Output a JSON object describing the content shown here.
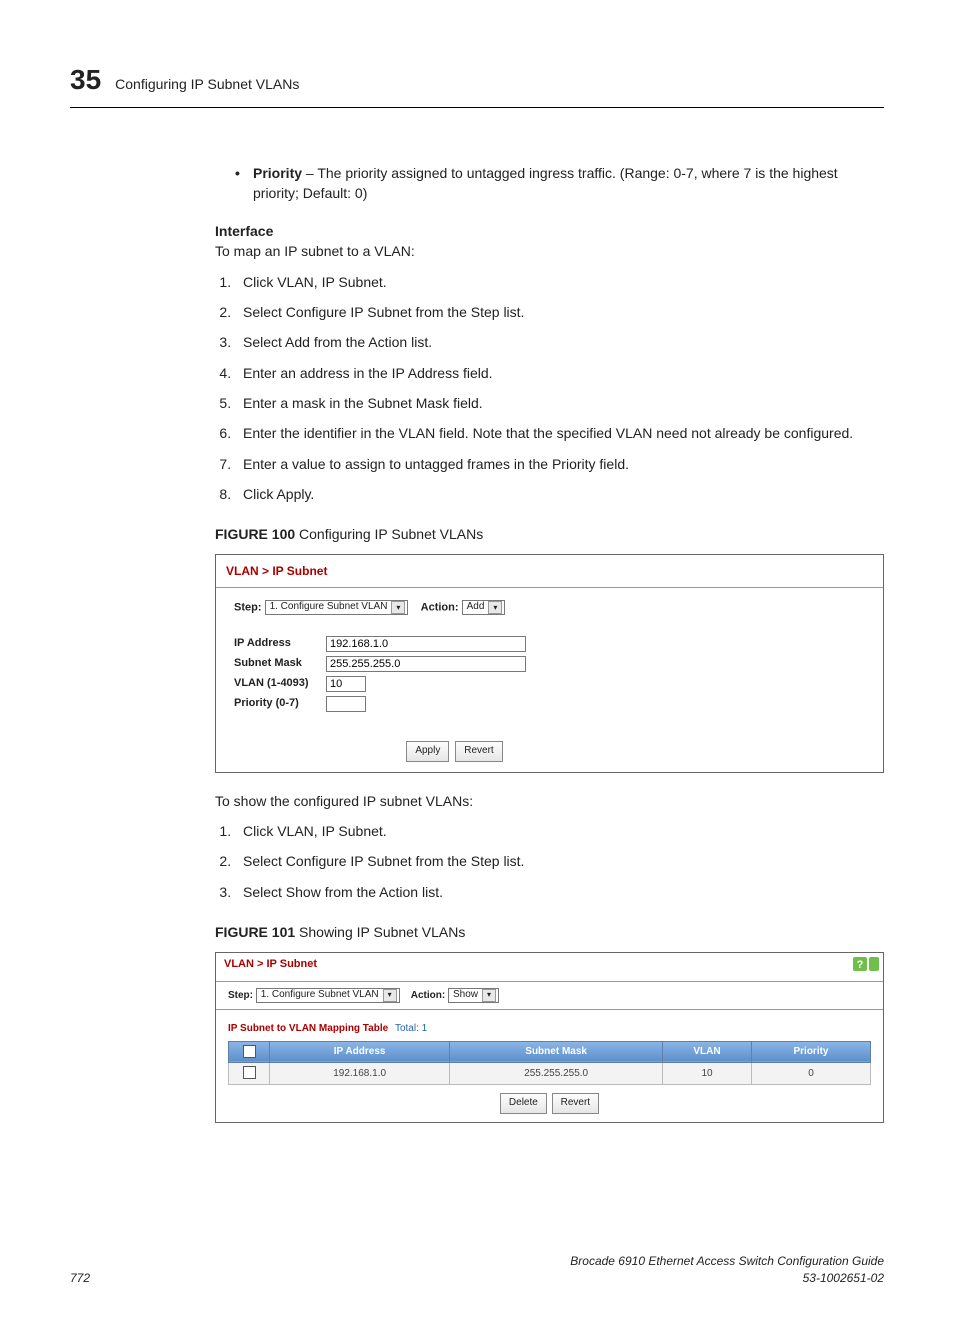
{
  "header": {
    "chapter_number": "35",
    "chapter_title": "Configuring IP Subnet VLANs"
  },
  "priority_bullet_label": "Priority",
  "priority_bullet_text": " – The priority assigned to untagged ingress traffic. (Range: 0-7, where 7 is the highest priority; Default: 0)",
  "interface": {
    "heading": "Interface",
    "intro": "To map an IP subnet to a VLAN:",
    "steps": [
      "Click VLAN, IP Subnet.",
      "Select Configure IP Subnet from the Step list.",
      "Select Add from the Action list.",
      "Enter an address in the IP Address field.",
      "Enter a mask in the Subnet Mask field.",
      "Enter the identifier in the VLAN field. Note that the specified VLAN need not already be configured.",
      "Enter a value to assign to untagged frames in the Priority field.",
      "Click Apply."
    ]
  },
  "figure100": {
    "label": "FIGURE 100",
    "title": "   Configuring IP Subnet VLANs",
    "breadcrumb": "VLAN > IP Subnet",
    "step_label": "Step:",
    "step_value": "1. Configure Subnet VLAN",
    "action_label": "Action:",
    "action_value": "Add",
    "fields": {
      "ip_label": "IP Address",
      "ip_value": "192.168.1.0",
      "mask_label": "Subnet Mask",
      "mask_value": "255.255.255.0",
      "vlan_label": "VLAN (1-4093)",
      "vlan_value": "10",
      "prio_label": "Priority (0-7)",
      "prio_value": ""
    },
    "apply": "Apply",
    "revert": "Revert"
  },
  "show_intro": "To show the configured IP subnet VLANs:",
  "show_steps": [
    "Click VLAN, IP Subnet.",
    "Select Configure IP Subnet from the Step list.",
    "Select Show from the Action list."
  ],
  "figure101": {
    "label": "FIGURE 101",
    "title": "   Showing IP Subnet VLANs",
    "breadcrumb": "VLAN > IP Subnet",
    "step_label": "Step:",
    "step_value": "1. Configure Subnet VLAN",
    "action_label": "Action:",
    "action_value": "Show",
    "table_title": "IP Subnet to VLAN Mapping Table",
    "table_total": "Total: 1",
    "headers": [
      "IP Address",
      "Subnet Mask",
      "VLAN",
      "Priority"
    ],
    "row": [
      "192.168.1.0",
      "255.255.255.0",
      "10",
      "0"
    ],
    "delete": "Delete",
    "revert": "Revert"
  },
  "footer": {
    "page": "772",
    "doc_title": "Brocade 6910 Ethernet Access Switch Configuration Guide",
    "doc_num": "53-1002651-02"
  }
}
